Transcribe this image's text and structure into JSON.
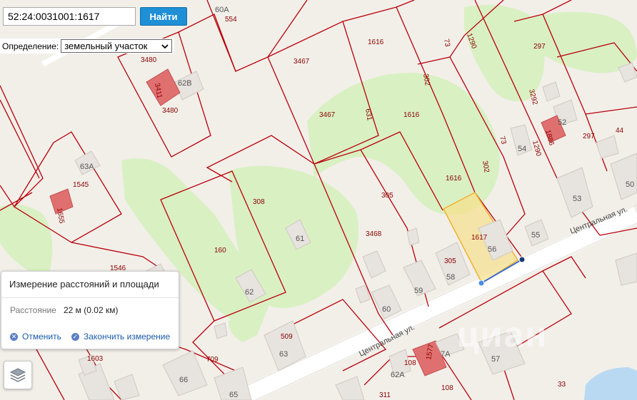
{
  "search": {
    "value": "52:24:0031001:1617",
    "button_label": "Найти"
  },
  "definition": {
    "label": "Определение:",
    "selected": "земельный участок"
  },
  "measure_panel": {
    "title": "Измерение расстояний и площади",
    "distance_label": "Расстояние",
    "distance_value": "22 м (0.02 км)",
    "cancel_label": "Отменить",
    "finish_label": "Закончить измерение"
  },
  "map": {
    "street_name_lower": "Центральная ул.",
    "street_name_upper": "Центральная ул.",
    "parcel_labels": [
      "1616",
      "1616",
      "1616",
      "1617",
      "3467",
      "3467",
      "3480",
      "3480",
      "631",
      "308",
      "305",
      "305",
      "3468",
      "160",
      "1545",
      "1546",
      "1655",
      "1603",
      "709",
      "509",
      "311",
      "108",
      "108",
      "1577",
      "1290",
      "1290",
      "3292",
      "1886",
      "297",
      "297",
      "73",
      "73",
      "302",
      "302",
      "33",
      "554",
      "3411",
      "44"
    ],
    "house_labels": [
      "60А",
      "62В",
      "63А",
      "61",
      "62",
      "60",
      "63",
      "66",
      "65",
      "58",
      "59",
      "56",
      "55",
      "54",
      "52",
      "53",
      "50",
      "57",
      "62А",
      "7А"
    ],
    "highlight_color": "#f7e08a",
    "parcel_line_color": "#b8000a",
    "measure_color": "#3b6fd0"
  },
  "watermark": "циан"
}
